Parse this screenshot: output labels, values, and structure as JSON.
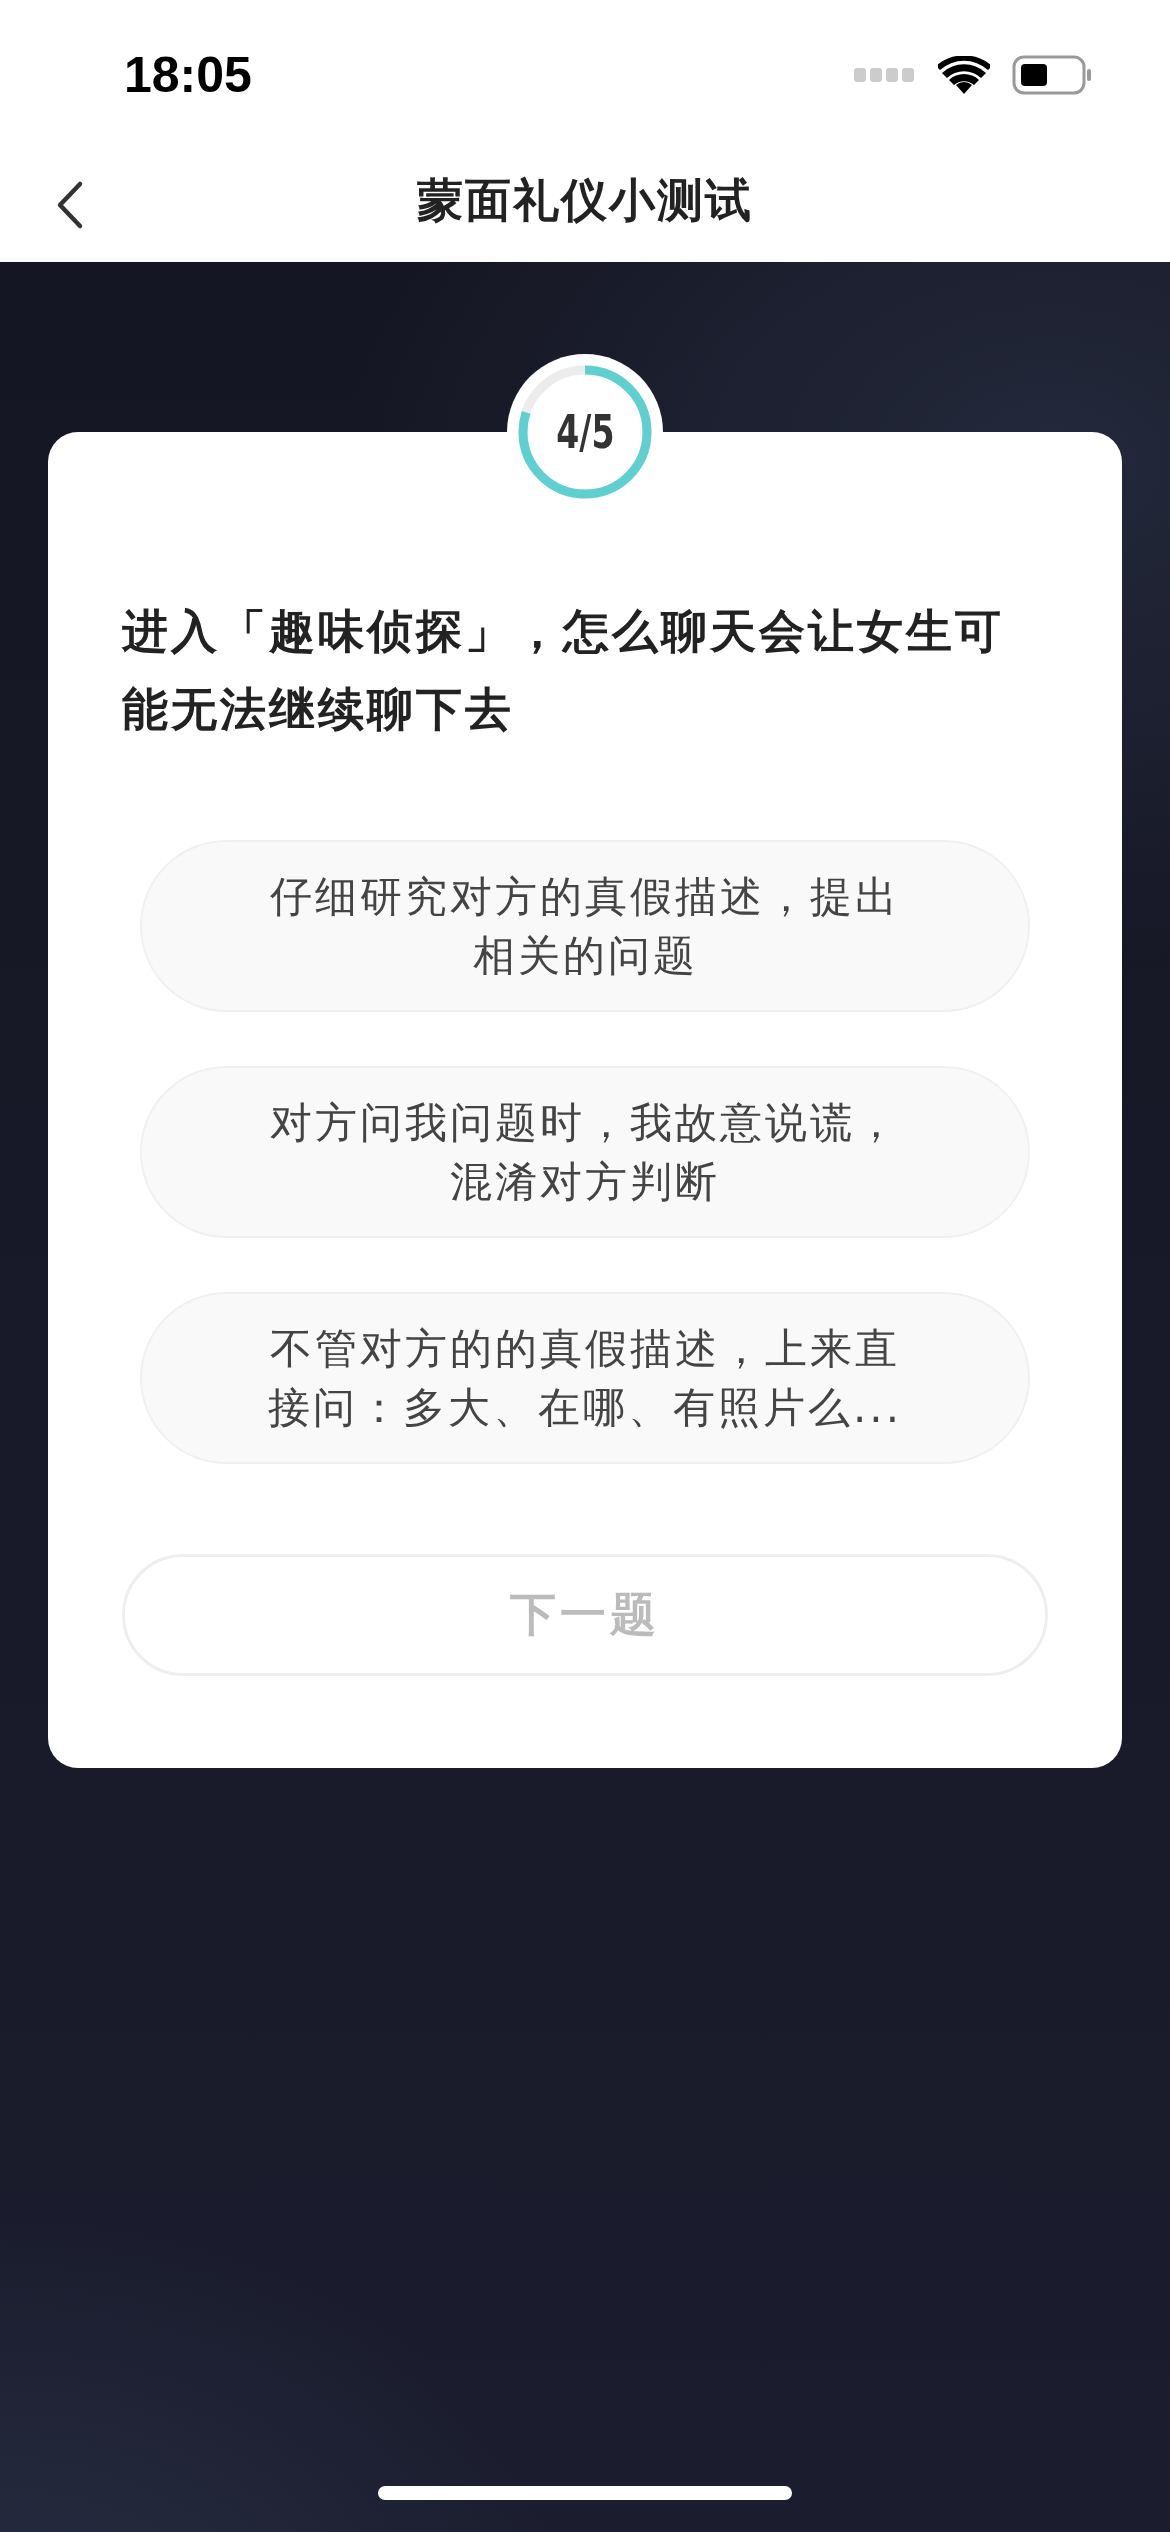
{
  "status_bar": {
    "time": "18:05"
  },
  "nav": {
    "title": "蒙面礼仪小测试"
  },
  "progress": {
    "label": "4/5",
    "level": 0.8
  },
  "question": "进入「趣味侦探」，怎么聊天会让女生可能无法继续聊下去",
  "options": [
    {
      "text": "仔细研究对方的真假描述，提出相关的问题",
      "selected": false
    },
    {
      "text": "对方问我问题时，我故意说谎，混淆对方判断",
      "selected": false
    },
    {
      "text": "不管对方的的真假描述，上来直接问：多大、在哪、有照片么...",
      "selected": false
    }
  ],
  "next_button": {
    "label": "下一题",
    "disabled": true
  }
}
